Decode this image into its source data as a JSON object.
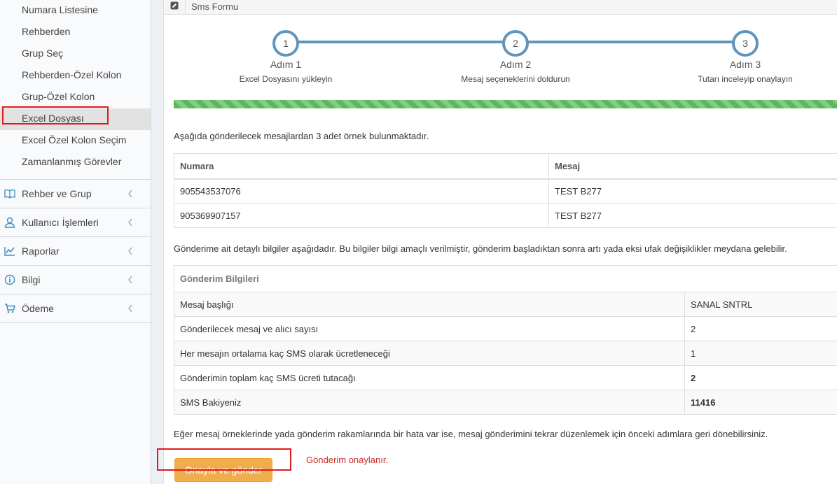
{
  "sidebar": {
    "sub_items": [
      {
        "label": "Numara Listesine"
      },
      {
        "label": "Rehberden"
      },
      {
        "label": "Grup Seç"
      },
      {
        "label": "Rehberden-Özel Kolon"
      },
      {
        "label": "Grup-Özel Kolon"
      },
      {
        "label": "Excel Dosyası"
      },
      {
        "label": "Excel Özel Kolon Seçim"
      },
      {
        "label": "Zamanlanmış Görevler"
      }
    ],
    "menu_items": [
      {
        "label": "Rehber ve Grup",
        "icon": "book-icon"
      },
      {
        "label": "Kullanıcı İşlemleri",
        "icon": "users-icon"
      },
      {
        "label": "Raporlar",
        "icon": "line-chart-icon"
      },
      {
        "label": "Bilgi",
        "icon": "info-icon"
      },
      {
        "label": "Ödeme",
        "icon": "cart-icon"
      }
    ]
  },
  "panel": {
    "title": "Sms Formu"
  },
  "wizard": {
    "steps": [
      {
        "number": "1",
        "label": "Adım 1",
        "desc": "Excel Dosyasını yükleyin"
      },
      {
        "number": "2",
        "label": "Adım 2",
        "desc": "Mesaj seçeneklerini doldurun"
      },
      {
        "number": "3",
        "label": "Adım 3",
        "desc": "Tutarı inceleyip onaylayın"
      }
    ]
  },
  "content": {
    "sample_intro": "Aşağıda gönderilecek mesajlardan 3 adet örnek bulunmaktadır.",
    "samples_table": {
      "headers": [
        "Numara",
        "Mesaj"
      ],
      "rows": [
        [
          "905543537076",
          "TEST B277"
        ],
        [
          "905369907157",
          "TEST B277"
        ]
      ]
    },
    "details_intro": "Gönderime ait detaylı bilgiler aşağıdadır. Bu bilgiler bilgi amaçlı verilmiştir, gönderim başladıktan sonra artı yada eksi ufak değişiklikler meydana gelebilir.",
    "details_table": {
      "caption": "Gönderim Bilgileri",
      "rows": [
        [
          "Mesaj başlığı",
          "SANAL SNTRL"
        ],
        [
          "Gönderilecek mesaj ve alıcı sayısı",
          "2"
        ],
        [
          "Her mesajın ortalama kaç SMS olarak ücretleneceği",
          "1"
        ],
        [
          "Gönderimin toplam kaç SMS ücreti tutacağı",
          "2"
        ],
        [
          "SMS Bakiyeniz",
          "11416"
        ]
      ]
    },
    "footer_note": "Eğer mesaj örneklerinde yada gönderim rakamlarında bir hata var ise, mesaj gönderimini tekrar düzenlemek için önceki adımlara geri dönebilirsiniz.",
    "confirm_button": "Onayla ve gönder",
    "annotation": "Gönderim onaylanır.",
    "progress_percent": 100
  },
  "colors": {
    "accent": "#6196bc",
    "progress": "#5cb85c",
    "button": "#f0ad4e",
    "highlight": "#e01b1b"
  }
}
